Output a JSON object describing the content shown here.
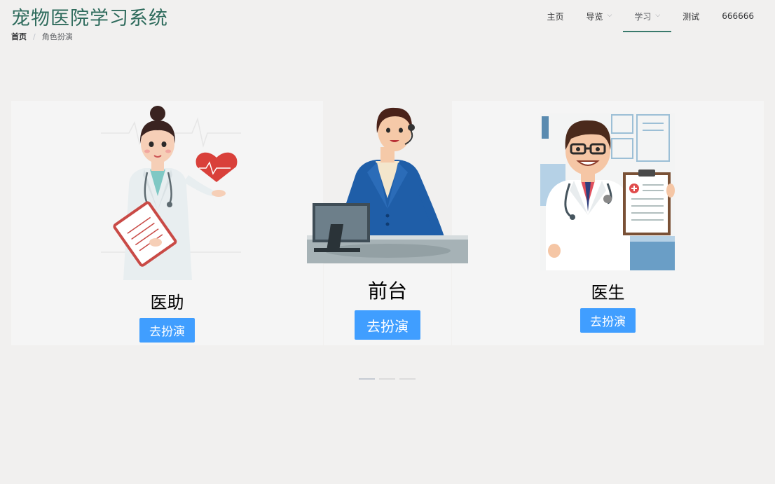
{
  "header": {
    "title": "宠物医院学习系统",
    "breadcrumb": {
      "home": "首页",
      "separator": "/",
      "current": "角色扮演"
    }
  },
  "nav": {
    "items": [
      {
        "label": "主页",
        "dropdown": false,
        "active": false
      },
      {
        "label": "导览",
        "dropdown": true,
        "active": false
      },
      {
        "label": "学习",
        "dropdown": true,
        "active": true
      },
      {
        "label": "测试",
        "dropdown": false,
        "active": false
      },
      {
        "label": "666666",
        "dropdown": false,
        "active": false
      }
    ],
    "chevron": "⌵"
  },
  "roles": [
    {
      "name": "医助",
      "button": "去扮演",
      "icon": "nurse-illustration"
    },
    {
      "name": "前台",
      "button": "去扮演",
      "icon": "receptionist-illustration"
    },
    {
      "name": "医生",
      "button": "去扮演",
      "icon": "doctor-illustration"
    }
  ],
  "carousel": {
    "count": 3,
    "active_index": 0
  },
  "colors": {
    "accent": "#409eff",
    "title": "#2e6b5c",
    "active_underline": "#3a7a6c",
    "background": "#f1f0ef"
  }
}
